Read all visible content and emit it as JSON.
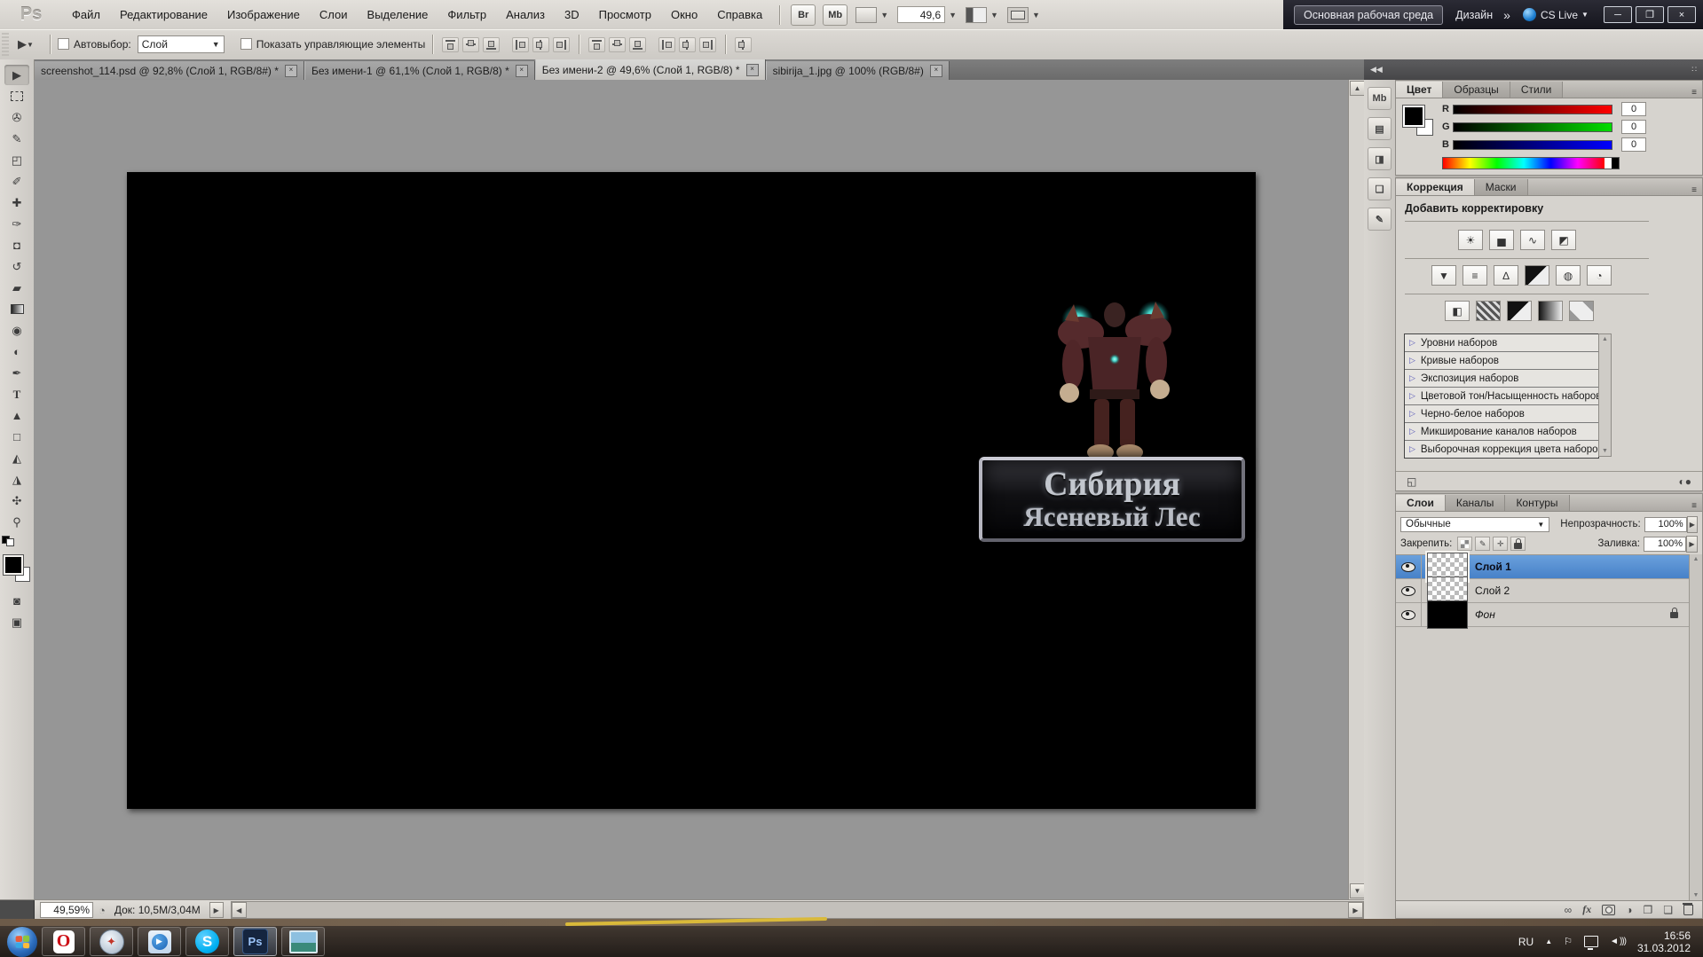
{
  "app": {
    "logo": "Ps"
  },
  "menubar": {
    "items": [
      "Файл",
      "Редактирование",
      "Изображение",
      "Слои",
      "Выделение",
      "Фильтр",
      "Анализ",
      "3D",
      "Просмотр",
      "Окно",
      "Справка"
    ]
  },
  "appbar": {
    "bridge": "Br",
    "mini_bridge": "Mb",
    "zoom_value": "49,6",
    "workspace_active": "Основная рабочая среда",
    "workspace_alt": "Дизайн",
    "overflow": "»",
    "cs_live": "CS Live"
  },
  "options": {
    "autoselect_label": "Автовыбор:",
    "autoselect_value": "Слой",
    "show_controls": "Показать управляющие элементы"
  },
  "doc_tabs": [
    {
      "title": "screenshot_114.psd @ 92,8% (Слой 1, RGB/8#) *"
    },
    {
      "title": "Без имени-1 @ 61,1% (Слой 1, RGB/8) *"
    },
    {
      "title": "Без имени-2 @ 49,6% (Слой 1, RGB/8) *"
    },
    {
      "title": "sibirija_1.jpg @ 100% (RGB/8#)"
    }
  ],
  "canvas": {
    "logo_line1": "Сибирия",
    "logo_line2": "Ясеневый Лес"
  },
  "color_panel": {
    "tabs": [
      "Цвет",
      "Образцы",
      "Стили"
    ],
    "channels": [
      {
        "label": "R",
        "value": "0"
      },
      {
        "label": "G",
        "value": "0"
      },
      {
        "label": "B",
        "value": "0"
      }
    ]
  },
  "adjustments": {
    "tabs": [
      "Коррекция",
      "Маски"
    ],
    "header": "Добавить корректировку",
    "presets": [
      "Уровни наборов",
      "Кривые наборов",
      "Экспозиция наборов",
      "Цветовой тон/Насыщенность наборов",
      "Черно-белое наборов",
      "Микширование каналов наборов",
      "Выборочная коррекция цвета наборов"
    ]
  },
  "layers": {
    "tabs": [
      "Слои",
      "Каналы",
      "Контуры"
    ],
    "blend_mode": "Обычные",
    "opacity_label": "Непрозрачность:",
    "opacity_value": "100%",
    "lock_label": "Закрепить:",
    "fill_label": "Заливка:",
    "fill_value": "100%",
    "fx_label": "fx",
    "items": [
      {
        "name": "Слой 1"
      },
      {
        "name": "Слой 2"
      },
      {
        "name": "Фон"
      }
    ]
  },
  "statusbar": {
    "zoom": "49,59%",
    "doc_info": "Док: 10,5М/3,04М"
  },
  "taskbar": {
    "tray_lang": "RU",
    "time": "16:56",
    "date": "31.03.2012"
  },
  "colors": {
    "selected_layer": "#4e86d0",
    "workspace_bar": "#14141c",
    "teal_glow": "#49e8dc",
    "taskbar_base": "#2a211b"
  },
  "icons": {
    "win_min": "─",
    "win_restore": "❐",
    "win_close": "×",
    "caret_down": "▼",
    "overflow_chevrons": "»",
    "collapse_left": "◀◀",
    "dock_dots": "∷",
    "tool_move": "▶",
    "tool_lasso": "✇",
    "tool_quickselect": "✎",
    "tool_crop": "◰",
    "tool_eyedropper": "✐",
    "tool_healing": "✚",
    "tool_brush": "✑",
    "tool_stamp": "◘",
    "tool_history": "↺",
    "tool_eraser": "▰",
    "tool_blur": "◉",
    "tool_dodge": "◐",
    "tool_pen": "✒",
    "tool_type": "T",
    "tool_pathselect": "▲",
    "tool_shape": "□",
    "tool_3drotate": "◭",
    "tool_3dcamera": "◮",
    "tool_hand": "✣",
    "tool_zoom": "⚲",
    "quickmask_icon": "◙",
    "screenmode_icon": "▣",
    "adj_brightness": "☀",
    "adj_levels": "▅",
    "adj_curves": "∿",
    "adj_exposure": "◩",
    "adj_vibrance": "▼",
    "adj_hue": "≡",
    "adj_balance": "∆",
    "adj_photofilter": "◍",
    "adj_mixer": "◔",
    "adj_invert": "◧",
    "adj_expand": "◱",
    "adj_clip": "◐●",
    "preset_tri": "▷",
    "lock_brush": "✎",
    "lock_move": "✛",
    "layers_link": "∞",
    "layers_adj": "◑",
    "layers_group": "❐",
    "layers_new": "❏",
    "scroll_up": "▲",
    "scroll_down": "▼",
    "scroll_left": "◀",
    "scroll_right": "▶",
    "spin_right": "▶",
    "status_clock": "◔",
    "dock_icon_1": "▤",
    "dock_icon_2": "◨",
    "dock_icon_3": "❏",
    "dock_icon_4": "✎",
    "tray_flag": "⚐",
    "tray_up": "▲",
    "speaker_body": "◄",
    "speaker_arcs": ")))",
    "opera_glyph": "O",
    "skype_glyph": "S",
    "ps_glyph": "Ps",
    "play_glyph": "▶",
    "safari_glyph": "✦",
    "menu_lines": "≡"
  }
}
